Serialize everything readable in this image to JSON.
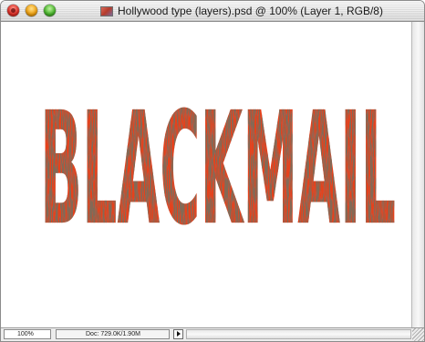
{
  "window": {
    "title": "Hollywood type (layers).psd @ 100% (Layer 1, RGB/8)",
    "icon": "psd-document-icon"
  },
  "artwork": {
    "text": "BLACKMAIL",
    "color": "#e5431e",
    "texture_color": "#3a2418"
  },
  "status": {
    "zoom": "100%",
    "doc_info": "Doc: 729.0K/1.90M"
  }
}
